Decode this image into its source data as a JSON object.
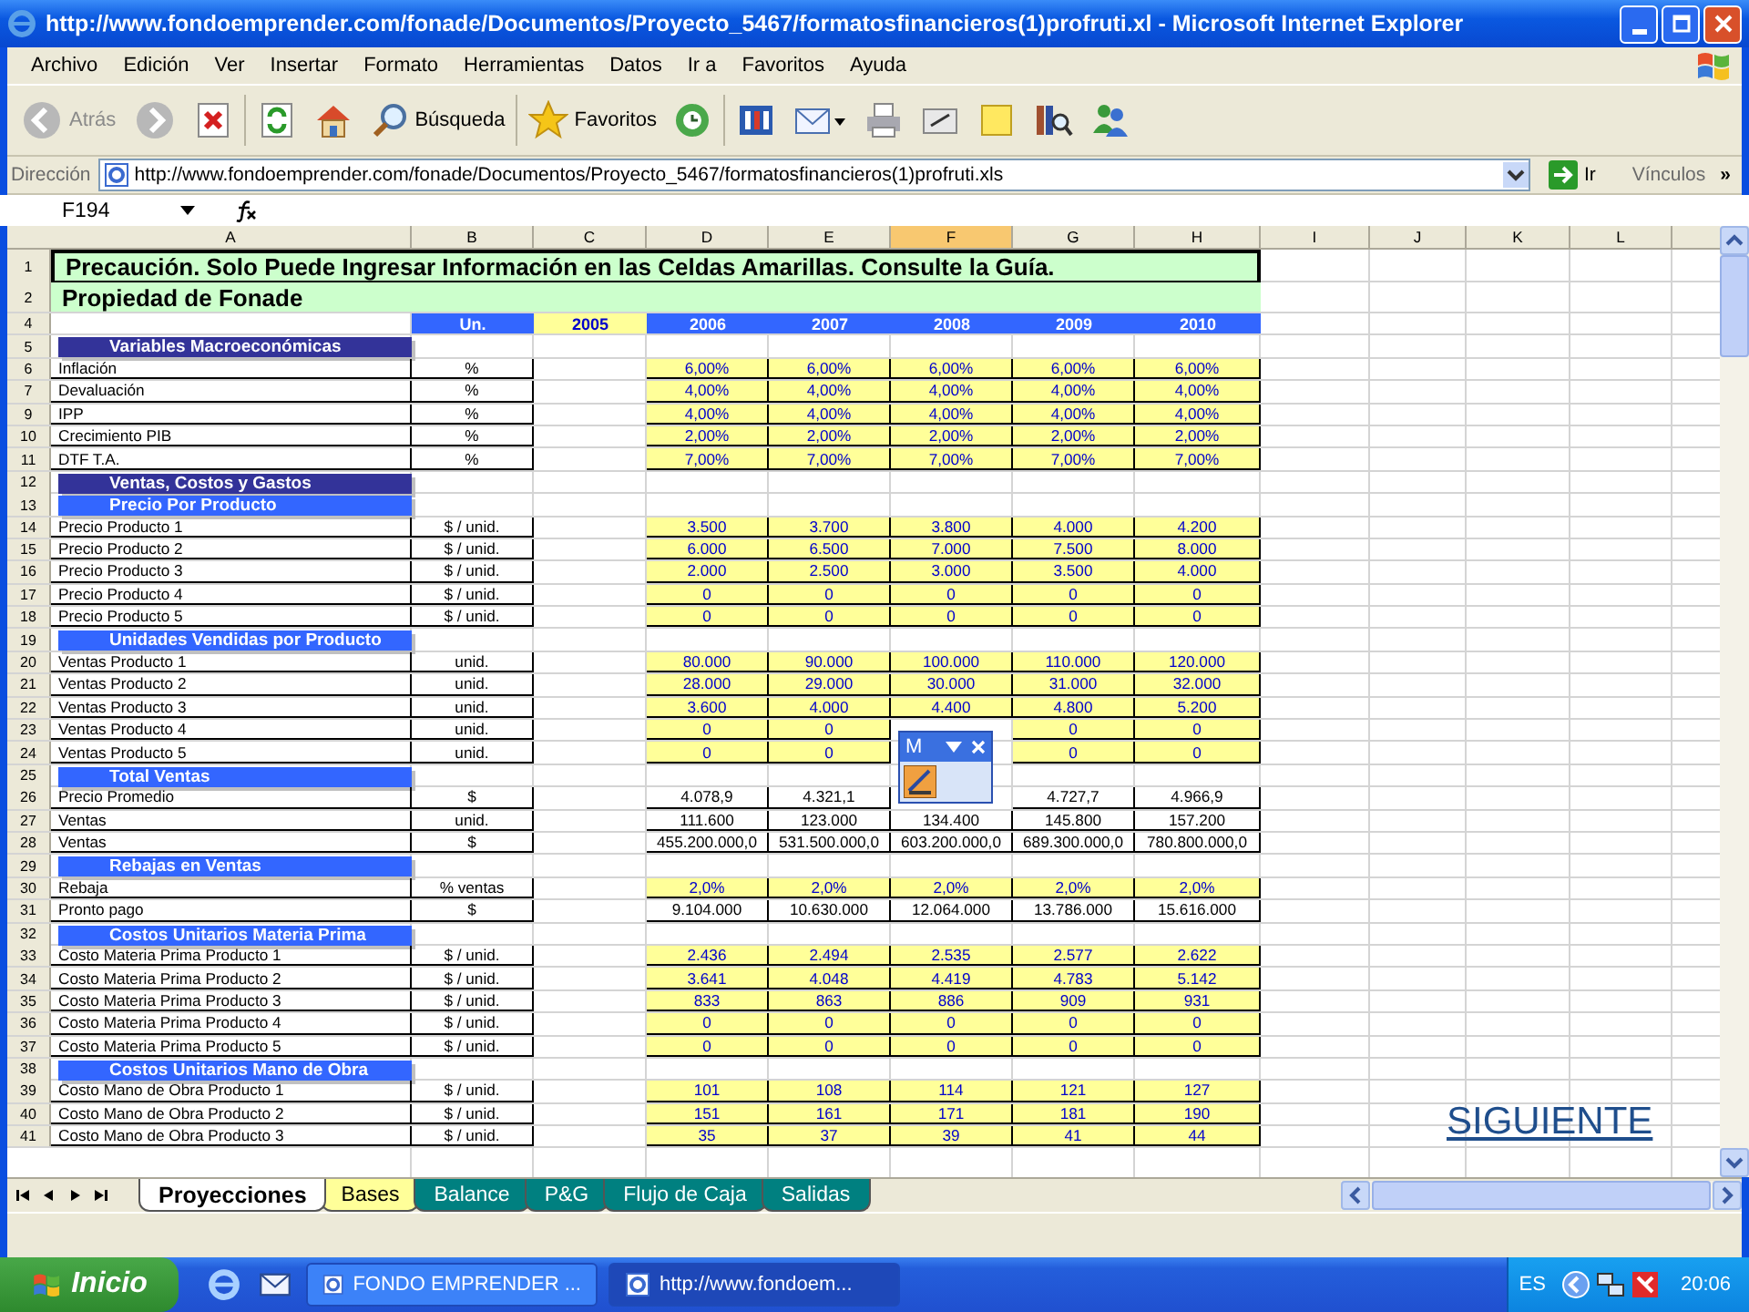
{
  "window": {
    "title": "http://www.fondoemprender.com/fonade/Documentos/Proyecto_5467/formatosfinancieros(1)profruti.xl - Microsoft Internet Explorer"
  },
  "menu": [
    "Archivo",
    "Edición",
    "Ver",
    "Insertar",
    "Formato",
    "Herramientas",
    "Datos",
    "Ir a",
    "Favoritos",
    "Ayuda"
  ],
  "toolbar": [
    {
      "kind": "back",
      "label": "Atrás",
      "disabled": true
    },
    {
      "kind": "forward",
      "disabled": true
    },
    {
      "kind": "stop"
    },
    {
      "kind": "refresh"
    },
    {
      "kind": "home"
    },
    {
      "kind": "search",
      "label": "Búsqueda"
    },
    {
      "kind": "favorites",
      "label": "Favoritos"
    },
    {
      "kind": "history"
    },
    {
      "kind": "media"
    },
    {
      "kind": "mail"
    },
    {
      "kind": "print"
    },
    {
      "kind": "edit"
    },
    {
      "kind": "note"
    },
    {
      "kind": "research"
    },
    {
      "kind": "messenger"
    }
  ],
  "address": {
    "label": "Dirección",
    "value": "http://www.fondoemprender.com/fonade/Documentos/Proyecto_5467/formatosfinancieros(1)profruti.xls",
    "go": "Ir",
    "links": "Vínculos",
    "more": "»"
  },
  "formula_bar": {
    "name_box": "F194"
  },
  "sheet": {
    "columns": [
      {
        "label": "A",
        "selected": false
      },
      {
        "label": "B",
        "selected": false
      },
      {
        "label": "C",
        "selected": false
      },
      {
        "label": "D",
        "selected": false
      },
      {
        "label": "E",
        "selected": false
      },
      {
        "label": "F",
        "selected": true
      },
      {
        "label": "G",
        "selected": false
      },
      {
        "label": "H",
        "selected": false
      },
      {
        "label": "I",
        "selected": false
      },
      {
        "label": "J",
        "selected": false
      },
      {
        "label": "K",
        "selected": false
      },
      {
        "label": "L",
        "selected": false
      }
    ],
    "rows": [
      {
        "num": "1",
        "kind": "notice",
        "label": "Precaución. Solo Puede Ingresar Información en las Celdas Amarillas. Consulte la Guía."
      },
      {
        "num": "2",
        "kind": "owner",
        "label": "Propiedad de Fonade"
      },
      {
        "num": "4",
        "kind": "years",
        "unit": "Un.",
        "base_year": "2005",
        "cells": [
          "2006",
          "2007",
          "2008",
          "2009",
          "2010"
        ]
      },
      {
        "num": "5",
        "kind": "group",
        "label": "Variables Macroeconómicas"
      },
      {
        "num": "6",
        "kind": "data",
        "label": "Inflación",
        "unit": "%",
        "input": true,
        "cells": [
          "6,00%",
          "6,00%",
          "6,00%",
          "6,00%",
          "6,00%"
        ]
      },
      {
        "num": "7",
        "kind": "data",
        "label": "Devaluación",
        "unit": "%",
        "input": true,
        "cells": [
          "4,00%",
          "4,00%",
          "4,00%",
          "4,00%",
          "4,00%"
        ]
      },
      {
        "num": "9",
        "kind": "data",
        "label": "IPP",
        "unit": "%",
        "input": true,
        "cells": [
          "4,00%",
          "4,00%",
          "4,00%",
          "4,00%",
          "4,00%"
        ]
      },
      {
        "num": "10",
        "kind": "data",
        "label": "Crecimiento PIB",
        "unit": "%",
        "input": true,
        "cells": [
          "2,00%",
          "2,00%",
          "2,00%",
          "2,00%",
          "2,00%"
        ]
      },
      {
        "num": "11",
        "kind": "data",
        "label": "DTF T.A.",
        "unit": "%",
        "input": true,
        "cells": [
          "7,00%",
          "7,00%",
          "7,00%",
          "7,00%",
          "7,00%"
        ]
      },
      {
        "num": "12",
        "kind": "group",
        "label": "Ventas, Costos y Gastos"
      },
      {
        "num": "13",
        "kind": "section",
        "label": "Precio Por Producto"
      },
      {
        "num": "14",
        "kind": "data",
        "label": "Precio Producto 1",
        "unit": "$ / unid.",
        "input": true,
        "cells": [
          "3.500",
          "3.700",
          "3.800",
          "4.000",
          "4.200"
        ]
      },
      {
        "num": "15",
        "kind": "data",
        "label": "Precio Producto 2",
        "unit": "$ / unid.",
        "input": true,
        "cells": [
          "6.000",
          "6.500",
          "7.000",
          "7.500",
          "8.000"
        ]
      },
      {
        "num": "16",
        "kind": "data",
        "label": "Precio Producto 3",
        "unit": "$ / unid.",
        "input": true,
        "cells": [
          "2.000",
          "2.500",
          "3.000",
          "3.500",
          "4.000"
        ]
      },
      {
        "num": "17",
        "kind": "data",
        "label": "Precio Producto 4",
        "unit": "$ / unid.",
        "input": true,
        "cells": [
          "0",
          "0",
          "0",
          "0",
          "0"
        ]
      },
      {
        "num": "18",
        "kind": "data",
        "label": "Precio Producto 5",
        "unit": "$ / unid.",
        "input": true,
        "cells": [
          "0",
          "0",
          "0",
          "0",
          "0"
        ]
      },
      {
        "num": "19",
        "kind": "section",
        "label": "Unidades Vendidas por Producto"
      },
      {
        "num": "20",
        "kind": "data",
        "label": "Ventas Producto 1",
        "unit": "unid.",
        "input": true,
        "cells": [
          "80.000",
          "90.000",
          "100.000",
          "110.000",
          "120.000"
        ]
      },
      {
        "num": "21",
        "kind": "data",
        "label": "Ventas Producto 2",
        "unit": "unid.",
        "input": true,
        "cells": [
          "28.000",
          "29.000",
          "30.000",
          "31.000",
          "32.000"
        ]
      },
      {
        "num": "22",
        "kind": "data",
        "label": "Ventas Producto 3",
        "unit": "unid.",
        "input": true,
        "cells": [
          "3.600",
          "4.000",
          "4.400",
          "4.800",
          "5.200"
        ]
      },
      {
        "num": "23",
        "kind": "data",
        "label": "Ventas Producto 4",
        "unit": "unid.",
        "input": true,
        "cells": [
          "0",
          "0",
          null,
          "0",
          "0"
        ]
      },
      {
        "num": "24",
        "kind": "data",
        "label": "Ventas Producto 5",
        "unit": "unid.",
        "input": true,
        "cells": [
          "0",
          "0",
          null,
          "0",
          "0"
        ]
      },
      {
        "num": "25",
        "kind": "section",
        "label": "Total Ventas"
      },
      {
        "num": "26",
        "kind": "data",
        "label": "Precio Promedio",
        "unit": "$",
        "input": false,
        "cells": [
          "4.078,9",
          "4.321,1",
          null,
          "4.727,7",
          "4.966,9"
        ]
      },
      {
        "num": "27",
        "kind": "data",
        "label": "Ventas",
        "unit": "unid.",
        "input": false,
        "cells": [
          "111.600",
          "123.000",
          "134.400",
          "145.800",
          "157.200"
        ]
      },
      {
        "num": "28",
        "kind": "data",
        "label": "Ventas",
        "unit": "$",
        "input": false,
        "cells": [
          "455.200.000,0",
          "531.500.000,0",
          "603.200.000,0",
          "689.300.000,0",
          "780.800.000,0"
        ]
      },
      {
        "num": "29",
        "kind": "section",
        "label": "Rebajas en Ventas"
      },
      {
        "num": "30",
        "kind": "data",
        "label": "Rebaja",
        "unit": "% ventas",
        "input": true,
        "cells": [
          "2,0%",
          "2,0%",
          "2,0%",
          "2,0%",
          "2,0%"
        ]
      },
      {
        "num": "31",
        "kind": "data",
        "label": "Pronto pago",
        "unit": "$",
        "input": false,
        "cells": [
          "9.104.000",
          "10.630.000",
          "12.064.000",
          "13.786.000",
          "15.616.000"
        ]
      },
      {
        "num": "32",
        "kind": "section",
        "label": "Costos Unitarios Materia Prima"
      },
      {
        "num": "33",
        "kind": "data",
        "label": "Costo Materia Prima Producto 1",
        "unit": "$ / unid.",
        "input": true,
        "cells": [
          "2.436",
          "2.494",
          "2.535",
          "2.577",
          "2.622"
        ]
      },
      {
        "num": "34",
        "kind": "data",
        "label": "Costo Materia Prima Producto 2",
        "unit": "$ / unid.",
        "input": true,
        "cells": [
          "3.641",
          "4.048",
          "4.419",
          "4.783",
          "5.142"
        ]
      },
      {
        "num": "35",
        "kind": "data",
        "label": "Costo Materia Prima Producto 3",
        "unit": "$ / unid.",
        "input": true,
        "cells": [
          "833",
          "863",
          "886",
          "909",
          "931"
        ]
      },
      {
        "num": "36",
        "kind": "data",
        "label": "Costo Materia Prima Producto 4",
        "unit": "$ / unid.",
        "input": true,
        "cells": [
          "0",
          "0",
          "0",
          "0",
          "0"
        ]
      },
      {
        "num": "37",
        "kind": "data",
        "label": "Costo Materia Prima Producto 5",
        "unit": "$ / unid.",
        "input": true,
        "cells": [
          "0",
          "0",
          "0",
          "0",
          "0"
        ]
      },
      {
        "num": "38",
        "kind": "section",
        "label": "Costos Unitarios Mano de Obra"
      },
      {
        "num": "39",
        "kind": "data",
        "label": "Costo Mano de Obra Producto 1",
        "unit": "$ / unid.",
        "input": true,
        "cells": [
          "101",
          "108",
          "114",
          "121",
          "127"
        ]
      },
      {
        "num": "40",
        "kind": "data",
        "label": "Costo Mano de Obra Producto 2",
        "unit": "$ / unid.",
        "input": true,
        "cells": [
          "151",
          "161",
          "171",
          "181",
          "190"
        ]
      },
      {
        "num": "41",
        "kind": "data",
        "label": "Costo Mano de Obra Producto 3",
        "unit": "$ / unid.",
        "input": true,
        "cells": [
          "35",
          "37",
          "39",
          "41",
          "44"
        ]
      }
    ]
  },
  "floating_toolbar": {
    "title": "M"
  },
  "link": "SIGUIENTE",
  "sheet_tabs": [
    {
      "label": "Proyecciones",
      "selected": true,
      "color": "#ffffff"
    },
    {
      "label": "Bases",
      "selected": false,
      "color": "#ffff99"
    },
    {
      "label": "Balance",
      "selected": false,
      "color": "#008080"
    },
    {
      "label": "P&G",
      "selected": false,
      "color": "#008080"
    },
    {
      "label": "Flujo de Caja",
      "selected": false,
      "color": "#008080"
    },
    {
      "label": "Salidas",
      "selected": false,
      "color": "#008080"
    }
  ],
  "taskbar": {
    "start": "Inicio",
    "tasks": [
      {
        "label": "FONDO EMPRENDER ...",
        "selected": false
      },
      {
        "label": "http://www.fondoem...",
        "selected": true
      }
    ],
    "language": "ES",
    "clock": "20:06"
  }
}
